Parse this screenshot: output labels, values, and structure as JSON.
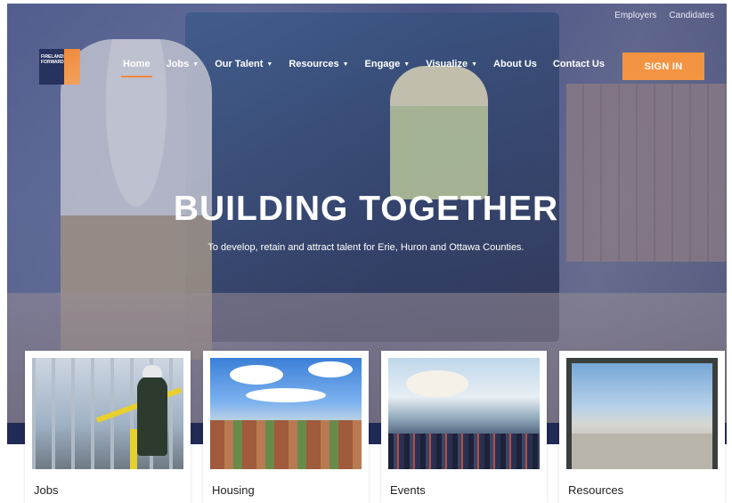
{
  "top_links": [
    "Employers",
    "Candidates"
  ],
  "logo": {
    "text": "FIRELANDS FORWARD"
  },
  "nav": {
    "items": [
      {
        "label": "Home",
        "has_dropdown": false,
        "active": true
      },
      {
        "label": "Jobs",
        "has_dropdown": true
      },
      {
        "label": "Our Talent",
        "has_dropdown": true
      },
      {
        "label": "Resources",
        "has_dropdown": true
      },
      {
        "label": "Engage",
        "has_dropdown": true
      },
      {
        "label": "Visualize",
        "has_dropdown": true
      },
      {
        "label": "About Us",
        "has_dropdown": false
      },
      {
        "label": "Contact Us",
        "has_dropdown": false
      }
    ],
    "signin_label": "SIGN IN"
  },
  "hero": {
    "headline": "BUILDING TOGETHER",
    "subhead": "To develop, retain and attract talent for Erie, Huron and Ottawa Counties."
  },
  "cards": [
    {
      "label": "Jobs"
    },
    {
      "label": "Housing"
    },
    {
      "label": "Events"
    },
    {
      "label": "Resources"
    }
  ],
  "colors": {
    "accent": "#f39443",
    "navy": "#27325f",
    "hero_overlay": "#3a4278"
  }
}
